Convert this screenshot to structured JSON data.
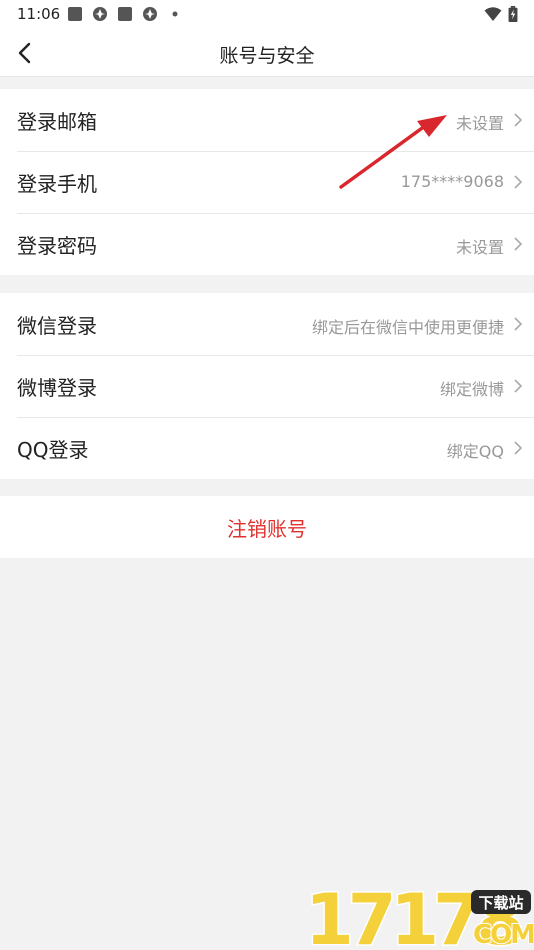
{
  "status_bar": {
    "time": "11:06",
    "icons": [
      "square-notification-icon",
      "pinwheel-icon",
      "square-notification-icon",
      "pinwheel-icon",
      "dot-icon",
      "wifi-icon",
      "battery-charging-icon"
    ]
  },
  "nav": {
    "back_icon": "chevron-left-icon",
    "title": "账号与安全"
  },
  "groups": [
    {
      "rows": [
        {
          "label": "登录邮箱",
          "value": "未设置"
        },
        {
          "label": "登录手机",
          "value": "175****9068"
        },
        {
          "label": "登录密码",
          "value": "未设置"
        }
      ]
    },
    {
      "rows": [
        {
          "label": "微信登录",
          "value": "绑定后在微信中使用更便捷"
        },
        {
          "label": "微博登录",
          "value": "绑定微博"
        },
        {
          "label": "QQ登录",
          "value": "绑定QQ"
        }
      ]
    }
  ],
  "logout": {
    "label": "注销账号"
  },
  "watermark": {
    "number": "17178",
    "badge": "下载站",
    "suffix": "COM"
  },
  "colors": {
    "background": "#f2f2f2",
    "card": "#ffffff",
    "danger": "#e0312e",
    "annotation_arrow": "#d9272e",
    "secondary_text": "#999999"
  }
}
